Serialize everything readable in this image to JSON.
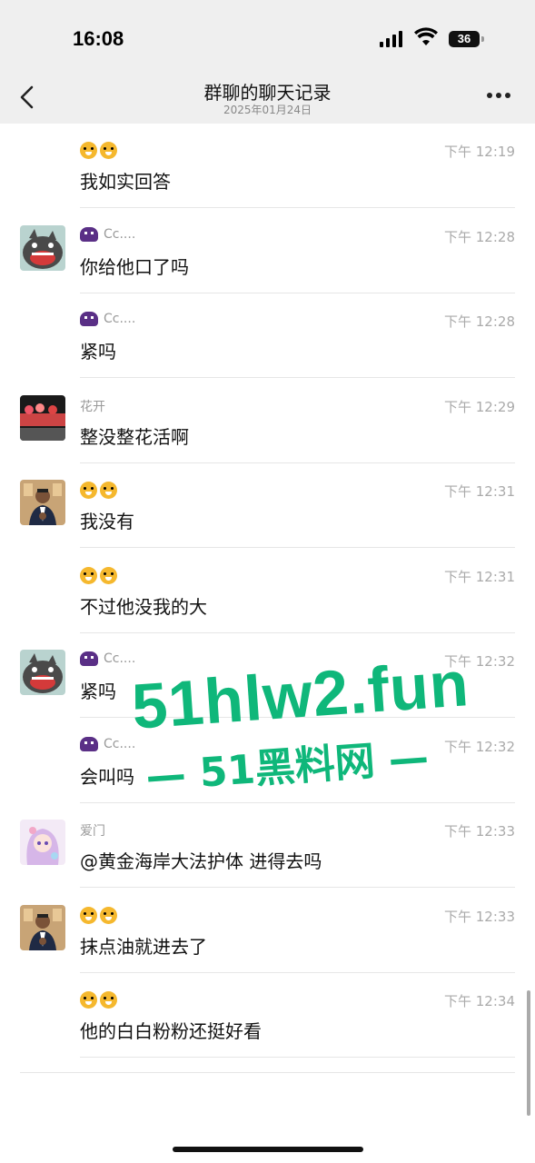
{
  "status_bar": {
    "time": "16:08",
    "battery": "36"
  },
  "header": {
    "title": "群聊的聊天记录",
    "date": "2025年01月24日"
  },
  "messages": [
    {
      "sender": "",
      "sender_emoji": "tiger",
      "time": "下午 12:19",
      "text": "我如实回答",
      "avatar": "none"
    },
    {
      "sender": "Cc....",
      "sender_emoji": "alien",
      "time": "下午 12:28",
      "text": "你给他口了吗",
      "avatar": "monster"
    },
    {
      "sender": "Cc....",
      "sender_emoji": "alien",
      "time": "下午 12:28",
      "text": "紧吗",
      "avatar": "none"
    },
    {
      "sender": "花开",
      "sender_emoji": "",
      "time": "下午 12:29",
      "text": "整没整花活啊",
      "avatar": "car"
    },
    {
      "sender": "",
      "sender_emoji": "tiger",
      "time": "下午 12:31",
      "text": "我没有",
      "avatar": "man"
    },
    {
      "sender": "",
      "sender_emoji": "tiger",
      "time": "下午 12:31",
      "text": "不过他没我的大",
      "avatar": "none"
    },
    {
      "sender": "Cc....",
      "sender_emoji": "alien",
      "time": "下午 12:32",
      "text": "紧吗",
      "avatar": "monster"
    },
    {
      "sender": "Cc....",
      "sender_emoji": "alien",
      "time": "下午 12:32",
      "text": "会叫吗",
      "avatar": "none"
    },
    {
      "sender": "爱门",
      "sender_emoji": "",
      "time": "下午 12:33",
      "text": "@黄金海岸大法护体 进得去吗",
      "avatar": "anime"
    },
    {
      "sender": "",
      "sender_emoji": "tiger",
      "time": "下午 12:33",
      "text": "抹点油就进去了",
      "avatar": "man"
    },
    {
      "sender": "",
      "sender_emoji": "tiger",
      "time": "下午 12:34",
      "text": "他的白白粉粉还挺好看",
      "avatar": "none"
    }
  ],
  "watermark": {
    "line1": "51hlw2.fun",
    "line2": "— 51黑料网 —"
  },
  "colors": {
    "watermark": "#0fb77a",
    "bar_bg": "#efefef"
  }
}
